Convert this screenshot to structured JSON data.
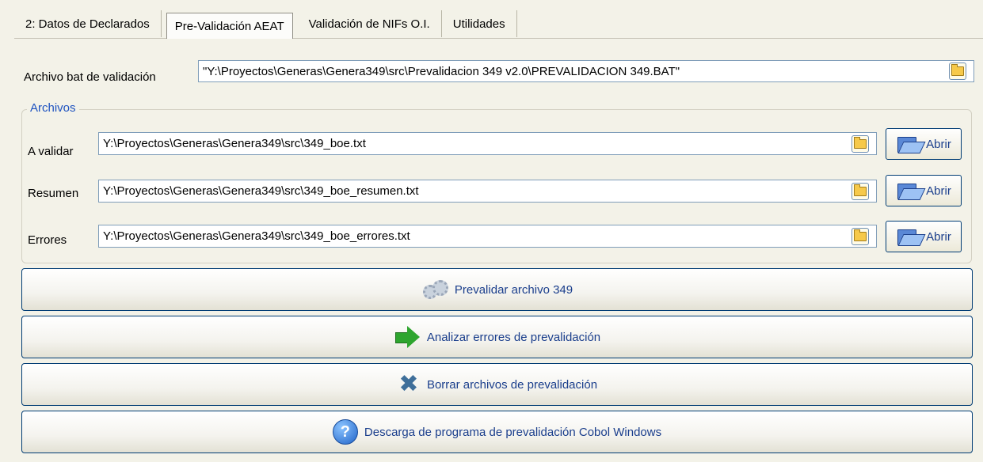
{
  "tabs": [
    {
      "label": "2: Datos de Declarados"
    },
    {
      "label": "Pre-Validación AEAT"
    },
    {
      "label": "Validación de NIFs O.I."
    },
    {
      "label": "Utilidades"
    }
  ],
  "bat": {
    "label": "Archivo bat de validación",
    "value": "\"Y:\\Proyectos\\Generas\\Genera349\\src\\Prevalidacion 349 v2.0\\PREVALIDACION 349.BAT\""
  },
  "archivos": {
    "title": "Archivos",
    "rows": [
      {
        "label": "A validar",
        "value": "Y:\\Proyectos\\Generas\\Genera349\\src\\349_boe.txt",
        "open_label": "Abrir"
      },
      {
        "label": "Resumen",
        "value": "Y:\\Proyectos\\Generas\\Genera349\\src\\349_boe_resumen.txt",
        "open_label": "Abrir"
      },
      {
        "label": "Errores",
        "value": "Y:\\Proyectos\\Generas\\Genera349\\src\\349_boe_errores.txt",
        "open_label": "Abrir"
      }
    ]
  },
  "actions": [
    {
      "label": "Prevalidar archivo 349",
      "icon": "gears-icon"
    },
    {
      "label": "Analizar errores de prevalidación",
      "icon": "arrow-right-icon"
    },
    {
      "label": "Borrar archivos de prevalidación",
      "icon": "delete-x-icon"
    },
    {
      "label": "Descarga de programa de prevalidación Cobol Windows",
      "icon": "help-icon"
    }
  ],
  "colors": {
    "background": "#f3f2e8",
    "accent": "#1a3e8c",
    "group_title": "#1d52c0",
    "border": "#003c74"
  }
}
